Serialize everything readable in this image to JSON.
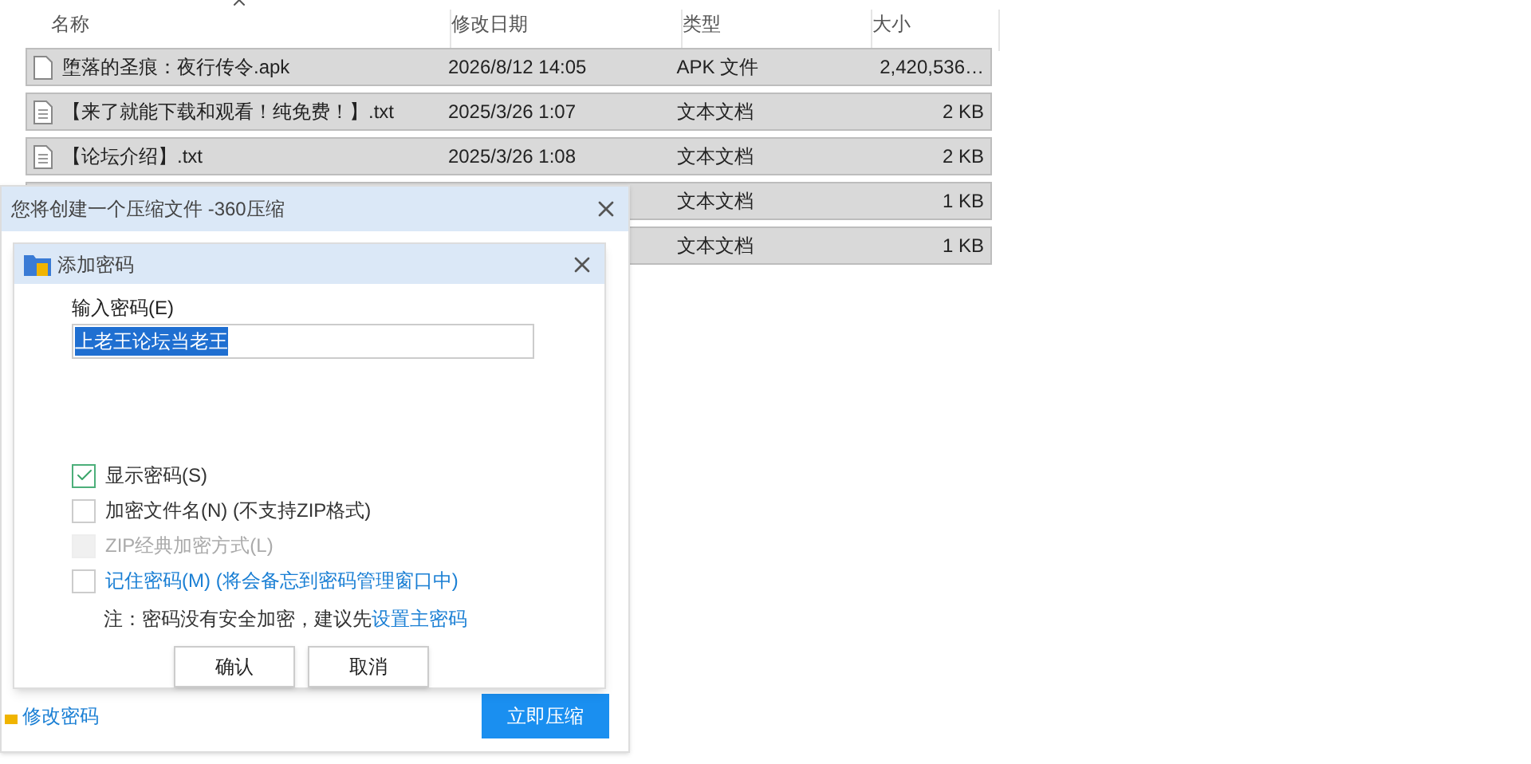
{
  "explorer": {
    "columns": [
      "名称",
      "修改日期",
      "类型",
      "大小"
    ],
    "rows": [
      {
        "kind": "apk",
        "name": "堕落的圣痕：夜行传令.apk",
        "date": "2026/8/12 14:05",
        "type": "APK 文件",
        "size": "2,420,536…",
        "selected": true
      },
      {
        "kind": "text",
        "name": "【来了就能下载和观看！纯免费！】.txt",
        "date": "2025/3/26 1:07",
        "type": "文本文档",
        "size": "2 KB",
        "selected": true
      },
      {
        "kind": "text",
        "name": "【论坛介绍】.txt",
        "date": "2025/3/26 1:08",
        "type": "文本文档",
        "size": "2 KB",
        "selected": true
      },
      {
        "type": "文本文档",
        "size": "1 KB",
        "selected": true
      },
      {
        "type": "文本文档",
        "size": "1 KB",
        "selected": true
      }
    ]
  },
  "compress_dialog": {
    "title": "您将创建一个压缩文件 -360压缩",
    "change_password_link": "修改密码",
    "start_button": "立即压缩"
  },
  "password_dialog": {
    "title": "添加密码",
    "field_label": "输入密码(E)",
    "password_value": "上老王论坛当老王",
    "options": [
      {
        "kind": "plain",
        "label": "显示密码(S)",
        "checked": true,
        "disabled": false
      },
      {
        "kind": "plain",
        "label": "加密文件名(N) (不支持ZIP格式)",
        "checked": false,
        "disabled": false
      },
      {
        "kind": "plain",
        "label": "ZIP经典加密方式(L)",
        "checked": false,
        "disabled": true
      },
      {
        "kind": "link",
        "label": "记住密码(M) (将会备忘到密码管理窗口中)",
        "checked": false,
        "disabled": false
      }
    ],
    "note": "注：密码没有安全加密，建议先",
    "note_link": "设置主密码",
    "buttons": [
      "确认",
      "取消"
    ]
  }
}
